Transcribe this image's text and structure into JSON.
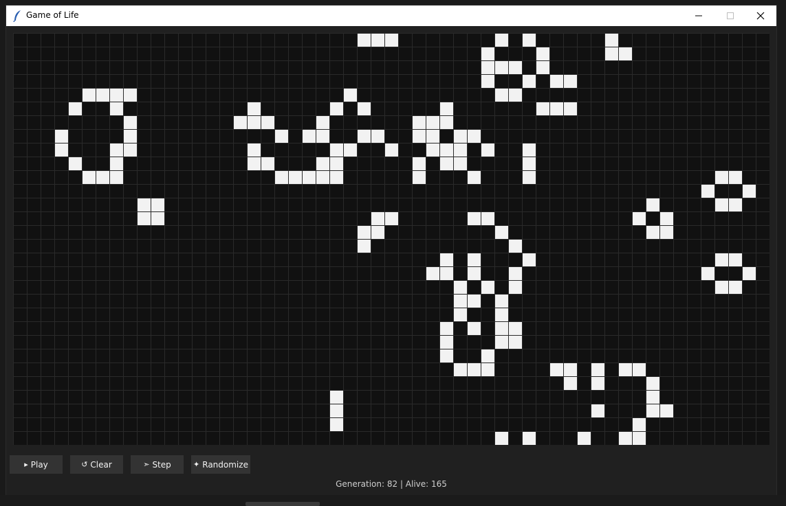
{
  "window": {
    "title": "Game of Life",
    "controls": [
      "minimize",
      "maximize",
      "close"
    ]
  },
  "colors": {
    "board_background": "#111111",
    "grid_line": "#2a2a2a",
    "alive_cell": "#f2f2f2",
    "button_background": "#333333",
    "window_background": "#202020"
  },
  "grid": {
    "cols": 55,
    "rows": 30,
    "alive": [
      [
        25,
        0
      ],
      [
        26,
        0
      ],
      [
        27,
        0
      ],
      [
        35,
        0
      ],
      [
        37,
        0
      ],
      [
        43,
        0
      ],
      [
        34,
        1
      ],
      [
        38,
        1
      ],
      [
        43,
        1
      ],
      [
        44,
        1
      ],
      [
        34,
        2
      ],
      [
        35,
        2
      ],
      [
        36,
        2
      ],
      [
        38,
        2
      ],
      [
        34,
        3
      ],
      [
        37,
        3
      ],
      [
        39,
        3
      ],
      [
        40,
        3
      ],
      [
        5,
        4
      ],
      [
        6,
        4
      ],
      [
        7,
        4
      ],
      [
        8,
        4
      ],
      [
        24,
        4
      ],
      [
        35,
        4
      ],
      [
        36,
        4
      ],
      [
        4,
        5
      ],
      [
        7,
        5
      ],
      [
        17,
        5
      ],
      [
        23,
        5
      ],
      [
        25,
        5
      ],
      [
        31,
        5
      ],
      [
        38,
        5
      ],
      [
        39,
        5
      ],
      [
        40,
        5
      ],
      [
        8,
        6
      ],
      [
        16,
        6
      ],
      [
        17,
        6
      ],
      [
        18,
        6
      ],
      [
        22,
        6
      ],
      [
        29,
        6
      ],
      [
        30,
        6
      ],
      [
        31,
        6
      ],
      [
        3,
        7
      ],
      [
        8,
        7
      ],
      [
        19,
        7
      ],
      [
        21,
        7
      ],
      [
        22,
        7
      ],
      [
        25,
        7
      ],
      [
        26,
        7
      ],
      [
        29,
        7
      ],
      [
        30,
        7
      ],
      [
        32,
        7
      ],
      [
        33,
        7
      ],
      [
        3,
        8
      ],
      [
        7,
        8
      ],
      [
        8,
        8
      ],
      [
        17,
        8
      ],
      [
        23,
        8
      ],
      [
        24,
        8
      ],
      [
        27,
        8
      ],
      [
        30,
        8
      ],
      [
        31,
        8
      ],
      [
        32,
        8
      ],
      [
        34,
        8
      ],
      [
        37,
        8
      ],
      [
        4,
        9
      ],
      [
        7,
        9
      ],
      [
        17,
        9
      ],
      [
        18,
        9
      ],
      [
        22,
        9
      ],
      [
        23,
        9
      ],
      [
        29,
        9
      ],
      [
        31,
        9
      ],
      [
        32,
        9
      ],
      [
        37,
        9
      ],
      [
        5,
        10
      ],
      [
        6,
        10
      ],
      [
        7,
        10
      ],
      [
        19,
        10
      ],
      [
        20,
        10
      ],
      [
        21,
        10
      ],
      [
        22,
        10
      ],
      [
        23,
        10
      ],
      [
        29,
        10
      ],
      [
        33,
        10
      ],
      [
        37,
        10
      ],
      [
        51,
        10
      ],
      [
        52,
        10
      ],
      [
        50,
        11
      ],
      [
        53,
        11
      ],
      [
        9,
        12
      ],
      [
        10,
        12
      ],
      [
        46,
        12
      ],
      [
        51,
        12
      ],
      [
        52,
        12
      ],
      [
        9,
        13
      ],
      [
        10,
        13
      ],
      [
        26,
        13
      ],
      [
        27,
        13
      ],
      [
        33,
        13
      ],
      [
        34,
        13
      ],
      [
        45,
        13
      ],
      [
        47,
        13
      ],
      [
        25,
        14
      ],
      [
        26,
        14
      ],
      [
        35,
        14
      ],
      [
        46,
        14
      ],
      [
        47,
        14
      ],
      [
        25,
        15
      ],
      [
        36,
        15
      ],
      [
        31,
        16
      ],
      [
        33,
        16
      ],
      [
        37,
        16
      ],
      [
        51,
        16
      ],
      [
        52,
        16
      ],
      [
        30,
        17
      ],
      [
        31,
        17
      ],
      [
        33,
        17
      ],
      [
        36,
        17
      ],
      [
        50,
        17
      ],
      [
        53,
        17
      ],
      [
        32,
        18
      ],
      [
        34,
        18
      ],
      [
        36,
        18
      ],
      [
        51,
        18
      ],
      [
        52,
        18
      ],
      [
        32,
        19
      ],
      [
        33,
        19
      ],
      [
        35,
        19
      ],
      [
        32,
        20
      ],
      [
        35,
        20
      ],
      [
        31,
        21
      ],
      [
        33,
        21
      ],
      [
        35,
        21
      ],
      [
        36,
        21
      ],
      [
        31,
        22
      ],
      [
        35,
        22
      ],
      [
        36,
        22
      ],
      [
        31,
        23
      ],
      [
        34,
        23
      ],
      [
        32,
        24
      ],
      [
        33,
        24
      ],
      [
        34,
        24
      ],
      [
        39,
        24
      ],
      [
        40,
        24
      ],
      [
        42,
        24
      ],
      [
        44,
        24
      ],
      [
        45,
        24
      ],
      [
        40,
        25
      ],
      [
        42,
        25
      ],
      [
        46,
        25
      ],
      [
        23,
        26
      ],
      [
        46,
        26
      ],
      [
        23,
        27
      ],
      [
        42,
        27
      ],
      [
        46,
        27
      ],
      [
        47,
        27
      ],
      [
        23,
        28
      ],
      [
        45,
        28
      ],
      [
        35,
        29
      ],
      [
        37,
        29
      ],
      [
        41,
        29
      ],
      [
        44,
        29
      ],
      [
        45,
        29
      ]
    ]
  },
  "buttons": {
    "play": {
      "icon": "play-icon",
      "glyph": "▸",
      "label": "Play"
    },
    "clear": {
      "icon": "reset-icon",
      "glyph": "↺",
      "label": "Clear"
    },
    "step": {
      "icon": "step-icon",
      "glyph": "➣",
      "label": "Step"
    },
    "randomize": {
      "icon": "sparkle-icon",
      "glyph": "✦",
      "label": "Randomize"
    }
  },
  "status": {
    "text": "Generation: 82 | Alive: 165",
    "generation": 82,
    "alive": 165
  }
}
